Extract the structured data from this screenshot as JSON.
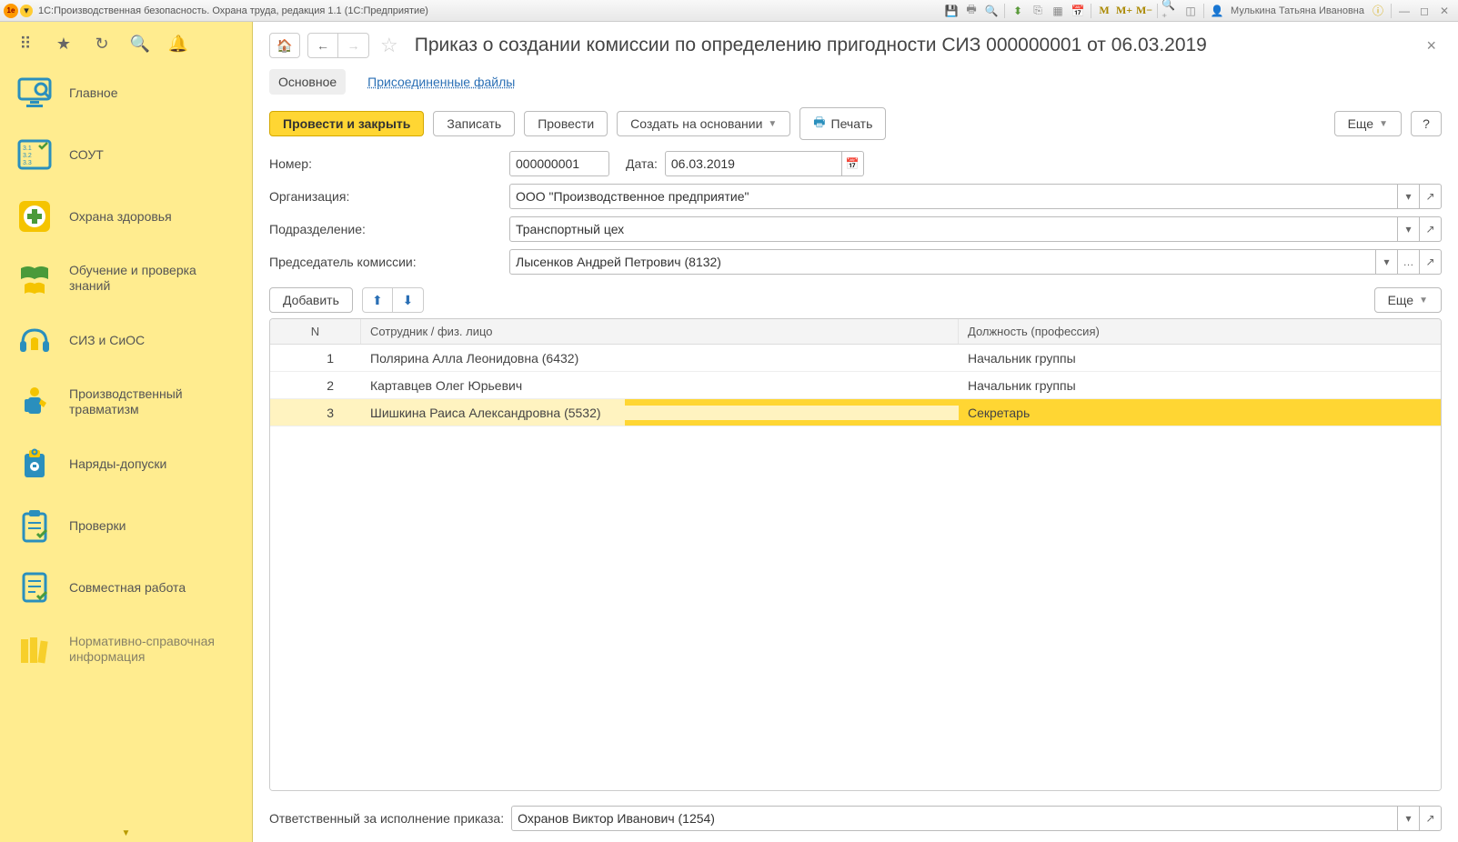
{
  "titlebar": {
    "app_title": "1С:Производственная безопасность. Охрана труда, редакция 1.1  (1С:Предприятие)",
    "user_name": "Мулькина Татьяна Ивановна"
  },
  "sidebar": {
    "items": [
      {
        "label": "Главное"
      },
      {
        "label": "СОУТ"
      },
      {
        "label": "Охрана здоровья"
      },
      {
        "label": "Обучение и проверка знаний"
      },
      {
        "label": "СИЗ и СиОС"
      },
      {
        "label": "Производственный травматизм"
      },
      {
        "label": "Наряды-допуски"
      },
      {
        "label": "Проверки"
      },
      {
        "label": "Совместная работа"
      },
      {
        "label": "Нормативно-справочная информация"
      }
    ]
  },
  "doc": {
    "title": "Приказ о создании комиссии по определению пригодности СИЗ 000000001 от 06.03.2019",
    "tabs": {
      "main": "Основное",
      "files": "Присоединенные файлы"
    },
    "actions": {
      "post_close": "Провести и закрыть",
      "save": "Записать",
      "post": "Провести",
      "create_based": "Создать на основании",
      "print": "Печать",
      "more": "Еще",
      "help": "?"
    },
    "form": {
      "number_label": "Номер:",
      "number_value": "000000001",
      "date_label": "Дата:",
      "date_value": "06.03.2019",
      "org_label": "Организация:",
      "org_value": "ООО \"Производственное предприятие\"",
      "dept_label": "Подразделение:",
      "dept_value": "Транспортный цех",
      "chair_label": "Председатель комиссии:",
      "chair_value": "Лысенков Андрей Петрович (8132)"
    },
    "table_actions": {
      "add": "Добавить",
      "more": "Еще"
    },
    "table_head": {
      "n": "N",
      "emp": "Сотрудник / физ. лицо",
      "pos": "Должность (профессия)"
    },
    "rows": [
      {
        "n": "1",
        "emp": "Полярина Алла  Леонидовна (6432)",
        "pos": "Начальник группы"
      },
      {
        "n": "2",
        "emp": "Картавцев Олег Юрьевич",
        "pos": "Начальник группы"
      },
      {
        "n": "3",
        "emp": "Шишкина Раиса Александровна (5532)",
        "pos": "Секретарь"
      }
    ],
    "responsible_label": "Ответственный за исполнение приказа:",
    "responsible_value": "Охранов Виктор Иванович (1254)"
  }
}
